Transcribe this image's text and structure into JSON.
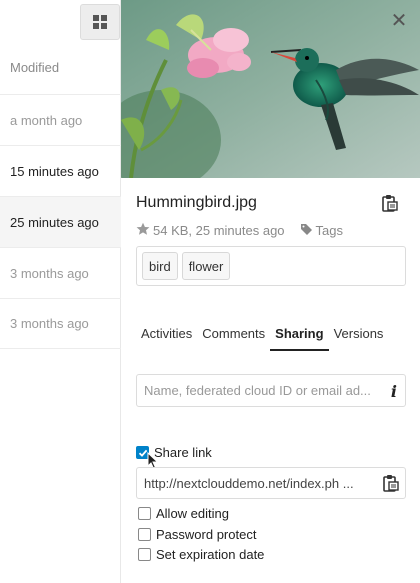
{
  "file_list": {
    "column_header": "Modified",
    "rows": [
      {
        "modified": "a month ago"
      },
      {
        "modified": "15 minutes ago"
      },
      {
        "modified": "25 minutes ago"
      },
      {
        "modified": "3 months ago"
      },
      {
        "modified": "3 months ago"
      }
    ]
  },
  "sidebar": {
    "filename": "Hummingbird.jpg",
    "meta": "54 KB, 25 minutes ago",
    "tags_label": "Tags",
    "tags": [
      "bird",
      "flower"
    ],
    "tabs": [
      {
        "label": "Activities"
      },
      {
        "label": "Comments"
      },
      {
        "label": "Sharing"
      },
      {
        "label": "Versions"
      }
    ],
    "active_tab": "Sharing",
    "share_placeholder": "Name, federated cloud ID or email ad...",
    "share_link_label": "Share link",
    "share_link_checked": true,
    "link_url": "http://nextclouddemo.net/index.ph ...",
    "options": [
      {
        "label": "Allow editing",
        "checked": false
      },
      {
        "label": "Password protect",
        "checked": false
      },
      {
        "label": "Set expiration date",
        "checked": false
      }
    ]
  },
  "colors": {
    "accent": "#0082c9"
  }
}
